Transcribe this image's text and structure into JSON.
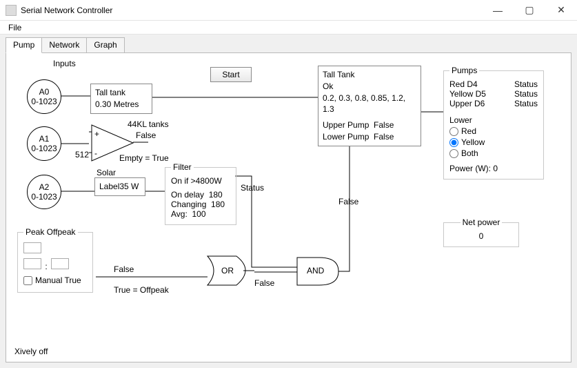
{
  "window": {
    "title": "Serial Network Controller"
  },
  "menu": {
    "file": "File"
  },
  "tabs": {
    "pump": "Pump",
    "network": "Network",
    "graph": "Graph"
  },
  "header": {
    "inputs": "Inputs"
  },
  "buttons": {
    "start": "Start"
  },
  "analog": {
    "a0": {
      "name": "A0",
      "range": "0-1023"
    },
    "a1": {
      "name": "A1",
      "range": "0-1023"
    },
    "a2": {
      "name": "A2",
      "range": "0-1023"
    }
  },
  "talltank_small": {
    "title": "Tall tank",
    "value": "0.30  Metres"
  },
  "comparator": {
    "plus": "+",
    "minus": "-",
    "threshold": "512",
    "title": "44KL tanks",
    "output": "False",
    "note": "Empty = True"
  },
  "solar": {
    "title": "Solar",
    "value": "Label35  W"
  },
  "filter": {
    "legend": "Filter",
    "cond": "On if >4800W",
    "ondelay_label": "On delay",
    "ondelay": "180",
    "changing_label": "Changing",
    "changing": "180",
    "avg_label": "Avg:",
    "avg": "100",
    "status": "Status"
  },
  "talltank_big": {
    "title": "Tall Tank",
    "status": "Ok",
    "levels": "0.2, 0.3, 0.8, 0.85, 1.2, 1.3",
    "upper_label": "Upper Pump",
    "upper": "False",
    "lower_label": "Lower Pump",
    "lower": "False"
  },
  "peak": {
    "legend": "Peak Offpeak",
    "manual_label": "Manual True",
    "out_label": "True = Offpeak",
    "output": "False"
  },
  "gates": {
    "or_label": "OR",
    "or_output": "False",
    "and_label": "AND",
    "and_side": "False"
  },
  "pumps_panel": {
    "legend": "Pumps",
    "rows": [
      {
        "name": "Red D4",
        "status": "Status"
      },
      {
        "name": "Yellow D5",
        "status": "Status"
      },
      {
        "name": "Upper D6",
        "status": "Status"
      }
    ],
    "lower_label": "Lower",
    "radios": {
      "red": "Red",
      "yellow": "Yellow",
      "both": "Both"
    },
    "power_label": "Power (W):",
    "power": "0"
  },
  "netpower": {
    "legend": "Net power",
    "value": "0"
  },
  "footer": {
    "xively": "Xively off"
  }
}
